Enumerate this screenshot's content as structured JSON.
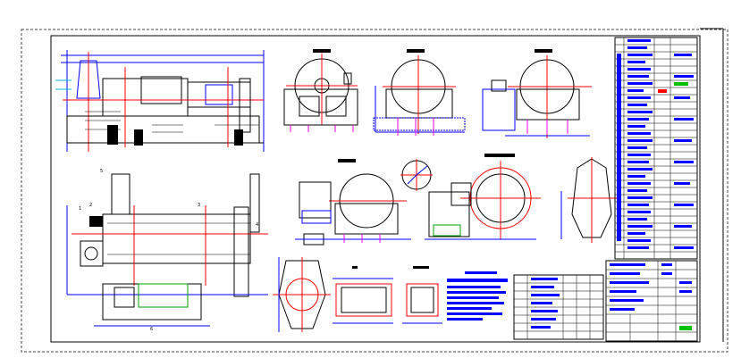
{
  "drawing": {
    "colors": {
      "paper": "#ffffff",
      "outline": "#000000",
      "dimension": "#0000ff",
      "centerline": "#ff0000",
      "anchor": "#ff00ff",
      "highlight": "#00a000"
    },
    "item_callouts": [
      "1",
      "2",
      "3",
      "4",
      "5",
      "6"
    ]
  }
}
